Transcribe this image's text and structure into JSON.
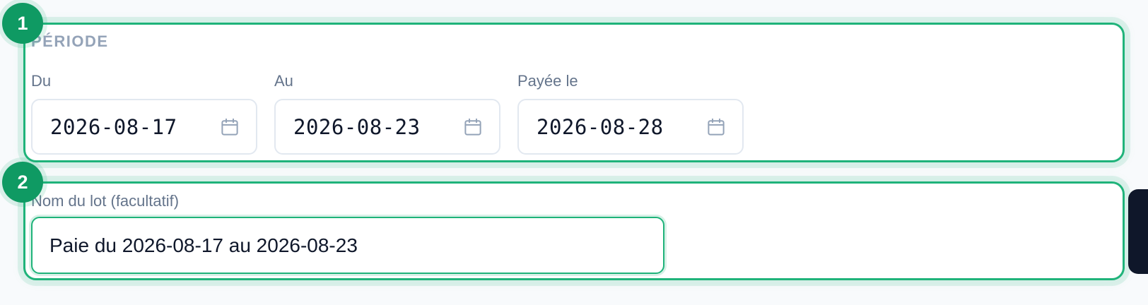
{
  "steps": {
    "period": {
      "number": "1",
      "heading": "PÉRIODE"
    },
    "batch": {
      "number": "2"
    }
  },
  "fields": {
    "du": {
      "label": "Du",
      "value": "2026-08-17",
      "icon": "calendar-icon"
    },
    "au": {
      "label": "Au",
      "value": "2026-08-23",
      "icon": "calendar-icon"
    },
    "payee_le": {
      "label": "Payée le",
      "value": "2026-08-28",
      "icon": "calendar-icon"
    }
  },
  "batch_name": {
    "label": "Nom du lot (facultatif)",
    "value": "Paie du 2026-08-17 au 2026-08-23"
  },
  "colors": {
    "highlight": "#1fb37a",
    "badge": "#0f9a63",
    "label": "#64748b",
    "heading": "#94a3b8",
    "text": "#0f172a"
  }
}
